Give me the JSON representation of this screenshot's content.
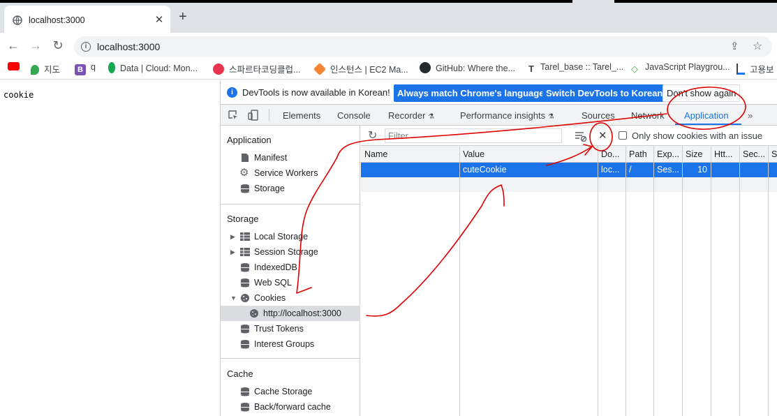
{
  "browser": {
    "tab_title": "localhost:3000",
    "tab_close": "✕",
    "new_tab": "+",
    "url": "localhost:3000"
  },
  "bookmarks": [
    {
      "label": "",
      "icon": "youtube-icon",
      "color": "#ff0000"
    },
    {
      "label": "지도",
      "icon": "maps-icon",
      "color": "#34a853"
    },
    {
      "label": "q",
      "icon": "bootstrap-icon",
      "color": "#7952b3"
    },
    {
      "label": "Data | Cloud: Mon...",
      "icon": "mongodb-icon",
      "color": "#13aa52"
    },
    {
      "label": "스파르타코딩클럽...",
      "icon": "sparta-icon",
      "color": "#e8344e"
    },
    {
      "label": "인스턴스 | EC2 Ma...",
      "icon": "aws-icon",
      "color": "#f58536"
    },
    {
      "label": "GitHub: Where the...",
      "icon": "github-icon",
      "color": "#24292e"
    },
    {
      "label": "Tarel_base :: Tarel_...",
      "icon": "tistory-icon",
      "color": "#3c4043"
    },
    {
      "label": "JavaScript Playgrou...",
      "icon": "playground-icon",
      "color": "#4caf50"
    },
    {
      "label": "고용보",
      "icon": "bookmark-icon",
      "color": "#1a73e8"
    }
  ],
  "page": {
    "body_text": "cookie"
  },
  "devtools": {
    "notice": {
      "message": "DevTools is now available in Korean!",
      "btn_match": "Always match Chrome's language",
      "btn_switch": "Switch DevTools to Korean",
      "btn_dismiss": "Don't show again"
    },
    "tabs": [
      "Elements",
      "Console",
      "Recorder",
      "Performance insights",
      "Sources",
      "Network",
      "Application"
    ],
    "active_tab": "Application",
    "more_tabs": "»",
    "sidebar": {
      "application_header": "Application",
      "application_items": [
        "Manifest",
        "Service Workers",
        "Storage"
      ],
      "storage_header": "Storage",
      "storage_items": [
        "Local Storage",
        "Session Storage",
        "IndexedDB",
        "Web SQL",
        "Cookies"
      ],
      "cookie_origin": "http://localhost:3000",
      "storage_items_after": [
        "Trust Tokens",
        "Interest Groups"
      ],
      "cache_header": "Cache",
      "cache_items": [
        "Cache Storage",
        "Back/forward cache"
      ]
    },
    "cookies": {
      "filter_placeholder": "Filter",
      "clear_icon": "✕",
      "only_issues_label": "Only show cookies with an issue",
      "columns": [
        "Name",
        "Value",
        "Do...",
        "Path",
        "Exp...",
        "Size",
        "Htt...",
        "Sec...",
        "Sa"
      ],
      "rows": [
        {
          "name": "",
          "value": "cuteCookie",
          "domain": "loc...",
          "path": "/",
          "expires": "Ses...",
          "size": "10",
          "http": "",
          "secure": "",
          "same": ""
        }
      ]
    },
    "accent_color": "#1a73e8"
  }
}
